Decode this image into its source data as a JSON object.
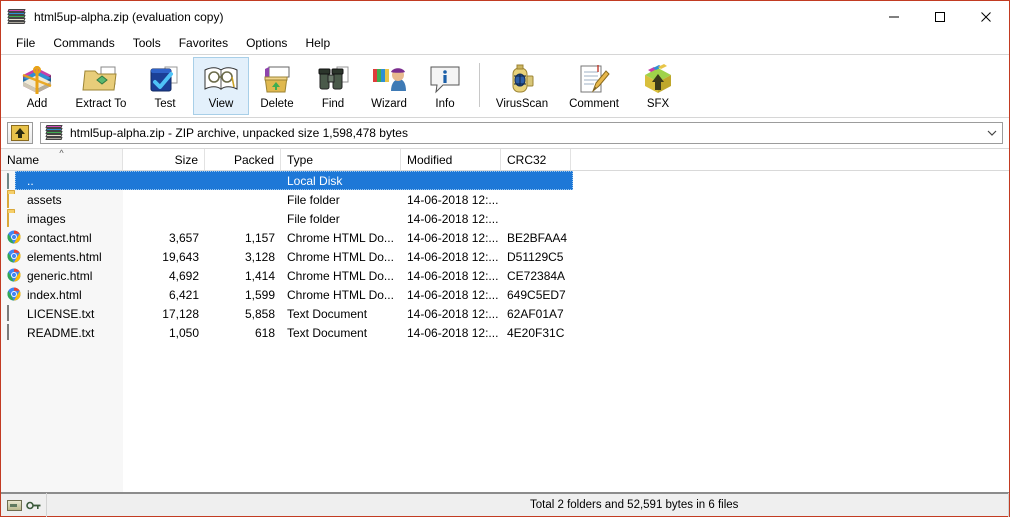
{
  "window": {
    "title": "html5up-alpha.zip (evaluation copy)",
    "icon": "winrar-books-icon",
    "accent_border": "#c23b22",
    "controls": {
      "minimize": "minimize-icon",
      "maximize": "maximize-icon",
      "close": "close-icon"
    }
  },
  "menu": {
    "items": [
      {
        "label": "File"
      },
      {
        "label": "Commands"
      },
      {
        "label": "Tools"
      },
      {
        "label": "Favorites"
      },
      {
        "label": "Options"
      },
      {
        "label": "Help"
      }
    ]
  },
  "toolbar": {
    "buttons": [
      {
        "label": "Add",
        "icon": "add-archive-icon",
        "state": "normal"
      },
      {
        "label": "Extract To",
        "icon": "extract-to-icon",
        "state": "normal"
      },
      {
        "label": "Test",
        "icon": "test-icon",
        "state": "normal"
      },
      {
        "label": "View",
        "icon": "view-icon",
        "state": "hot"
      },
      {
        "label": "Delete",
        "icon": "delete-icon",
        "state": "normal"
      },
      {
        "label": "Find",
        "icon": "find-binoculars-icon",
        "state": "normal"
      },
      {
        "label": "Wizard",
        "icon": "wizard-icon",
        "state": "normal"
      },
      {
        "label": "Info",
        "icon": "info-icon",
        "state": "normal"
      },
      {
        "label": "VirusScan",
        "icon": "virusscan-icon",
        "state": "normal"
      },
      {
        "label": "Comment",
        "icon": "comment-icon",
        "state": "normal"
      },
      {
        "label": "SFX",
        "icon": "sfx-icon",
        "state": "normal"
      }
    ],
    "separator_after": "Info"
  },
  "pathbar": {
    "up_button_icon": "folder-up-arrow-icon",
    "archive_icon": "winrar-books-icon",
    "text": "html5up-alpha.zip - ZIP archive, unpacked size 1,598,478 bytes",
    "dropdown_icon": "chevron-down-icon"
  },
  "list": {
    "columns": [
      {
        "label": "Name",
        "align": "left",
        "sorted": true,
        "sort_dir": "asc"
      },
      {
        "label": "Size",
        "align": "right",
        "sorted": false
      },
      {
        "label": "Packed",
        "align": "right",
        "sorted": false
      },
      {
        "label": "Type",
        "align": "left",
        "sorted": false
      },
      {
        "label": "Modified",
        "align": "left",
        "sorted": false
      },
      {
        "label": "CRC32",
        "align": "left",
        "sorted": false
      }
    ],
    "rows": [
      {
        "icon": "folder-up-icon",
        "name": "..",
        "size": "",
        "packed": "",
        "type": "Local Disk",
        "modified": "",
        "crc32": "",
        "selected": true
      },
      {
        "icon": "folder-icon",
        "name": "assets",
        "size": "",
        "packed": "",
        "type": "File folder",
        "modified": "14-06-2018 12:...",
        "crc32": "",
        "selected": false
      },
      {
        "icon": "folder-icon",
        "name": "images",
        "size": "",
        "packed": "",
        "type": "File folder",
        "modified": "14-06-2018 12:...",
        "crc32": "",
        "selected": false
      },
      {
        "icon": "chrome-html-icon",
        "name": "contact.html",
        "size": "3,657",
        "packed": "1,157",
        "type": "Chrome HTML Do...",
        "modified": "14-06-2018 12:...",
        "crc32": "BE2BFAA4",
        "selected": false
      },
      {
        "icon": "chrome-html-icon",
        "name": "elements.html",
        "size": "19,643",
        "packed": "3,128",
        "type": "Chrome HTML Do...",
        "modified": "14-06-2018 12:...",
        "crc32": "D51129C5",
        "selected": false
      },
      {
        "icon": "chrome-html-icon",
        "name": "generic.html",
        "size": "4,692",
        "packed": "1,414",
        "type": "Chrome HTML Do...",
        "modified": "14-06-2018 12:...",
        "crc32": "CE72384A",
        "selected": false
      },
      {
        "icon": "chrome-html-icon",
        "name": "index.html",
        "size": "6,421",
        "packed": "1,599",
        "type": "Chrome HTML Do...",
        "modified": "14-06-2018 12:...",
        "crc32": "649C5ED7",
        "selected": false
      },
      {
        "icon": "text-document-icon",
        "name": "LICENSE.txt",
        "size": "17,128",
        "packed": "5,858",
        "type": "Text Document",
        "modified": "14-06-2018 12:...",
        "crc32": "62AF01A7",
        "selected": false
      },
      {
        "icon": "text-document-icon",
        "name": "README.txt",
        "size": "1,050",
        "packed": "618",
        "type": "Text Document",
        "modified": "14-06-2018 12:...",
        "crc32": "4E20F31C",
        "selected": false
      }
    ],
    "selection_color": "#1e78d7"
  },
  "statusbar": {
    "left_icons": [
      {
        "icon": "drive-icon"
      },
      {
        "icon": "key-icon"
      }
    ],
    "status_text": "Total 2 folders and 52,591 bytes in 6 files"
  }
}
